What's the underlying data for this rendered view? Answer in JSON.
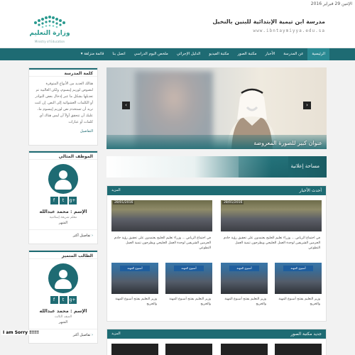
{
  "top": {
    "date": "الإثنين 29 فبراير 2016"
  },
  "header": {
    "school_name": "مدرسة ابن تيمية الإبتدائية للبنين بالنخيل",
    "school_url": "www.ibntaymiyya.edu.sa",
    "ministry_name": "وزارة التعليم",
    "ministry_sub": "Ministry of Education"
  },
  "nav": {
    "items": [
      "الرئيسية",
      "عن المدرسة",
      "الأخبار",
      "مكتبة الصور",
      "مكتبة الفيديو",
      "الدليل الإجرائي",
      "ملخص اليوم الدراسي",
      "اتصل بنا",
      "قائمة منزلقة ▾"
    ]
  },
  "sidebar": {
    "school_word": {
      "title": "كلمة المدرسة",
      "text": "هنالك العديد من الأنواع المتوفرة لنصوص لوريم إيبسوم، ولكن الغالبية تم تعديلها بشكل ما عبر إدخال بعض النوادر أو الكلمات العشوائية إلى النص. إن كنت تريد أن تستخدم نص لوريم إيبسوم ما، عليك أن تتحقق أولاً أن ليس هناك أي كلمات أو عبارات",
      "more": "التفاصيل"
    },
    "ideal_employee": {
      "title": "الموظف المثالي",
      "name": "الإسم : محمد عبدالله",
      "role": "معلم شريعة إسلامية",
      "month": "الشهر",
      "details": "تفاصيل أكثر"
    },
    "excellent_student": {
      "title": "الطالب المتميز",
      "name": "الإسم : محمد عبدالله",
      "grade": "الصف الثالث",
      "month": "الشهر",
      "details": "تفاصيل أكثر"
    },
    "social_icons": [
      "f",
      "t",
      "g+"
    ]
  },
  "slider": {
    "caption": "عنوان كبير للصورة المعروضة",
    "prev": "‹",
    "next": "›"
  },
  "ad": {
    "label": "مساحة إعلانية"
  },
  "news": {
    "title": "أحدث الأخبار",
    "more": "المزيد",
    "big": [
      {
        "date": "28/01/2016",
        "text": "في اجتماع الرياض ... وزراء تعليم الخليج يعتمدون على تحقيق رؤية خادم الحرمين الشريفين لوحدة العمل الخليجي ويطرحون تنمية العمل التطوعي"
      },
      {
        "date": "28/01/2016",
        "text": "في اجتماع الرياض ... وزراء تعليم الخليج يعتمدون على تحقيق رؤية خادم الحرمين الشريفين لوحدة العمل الخليجي ويطرحون تنمية العمل التطوعي"
      }
    ],
    "small": [
      {
        "banner": "أسبوع المهنة",
        "text": "وزير التعليم يفتتح أسبوع المهنة والخريج"
      },
      {
        "banner": "أسبوع المهنة",
        "text": "وزير التعليم يفتتح أسبوع المهنة والخريج"
      },
      {
        "banner": "أسبوع المهنة",
        "text": "وزير التعليم يفتتح أسبوع المهنة والخريج"
      },
      {
        "banner": "أسبوع المهنة",
        "text": "وزير التعليم يفتتح أسبوع المهنة والخريج"
      }
    ]
  },
  "gallery": {
    "title": "جديد مكتبة الصور",
    "more": "المزيد"
  },
  "overlay_text": "I am Sorry !!!!!",
  "colors": {
    "brand": "#1e6b73",
    "brand_light": "#2a8a93",
    "page_bg": "#f2f2f2"
  }
}
